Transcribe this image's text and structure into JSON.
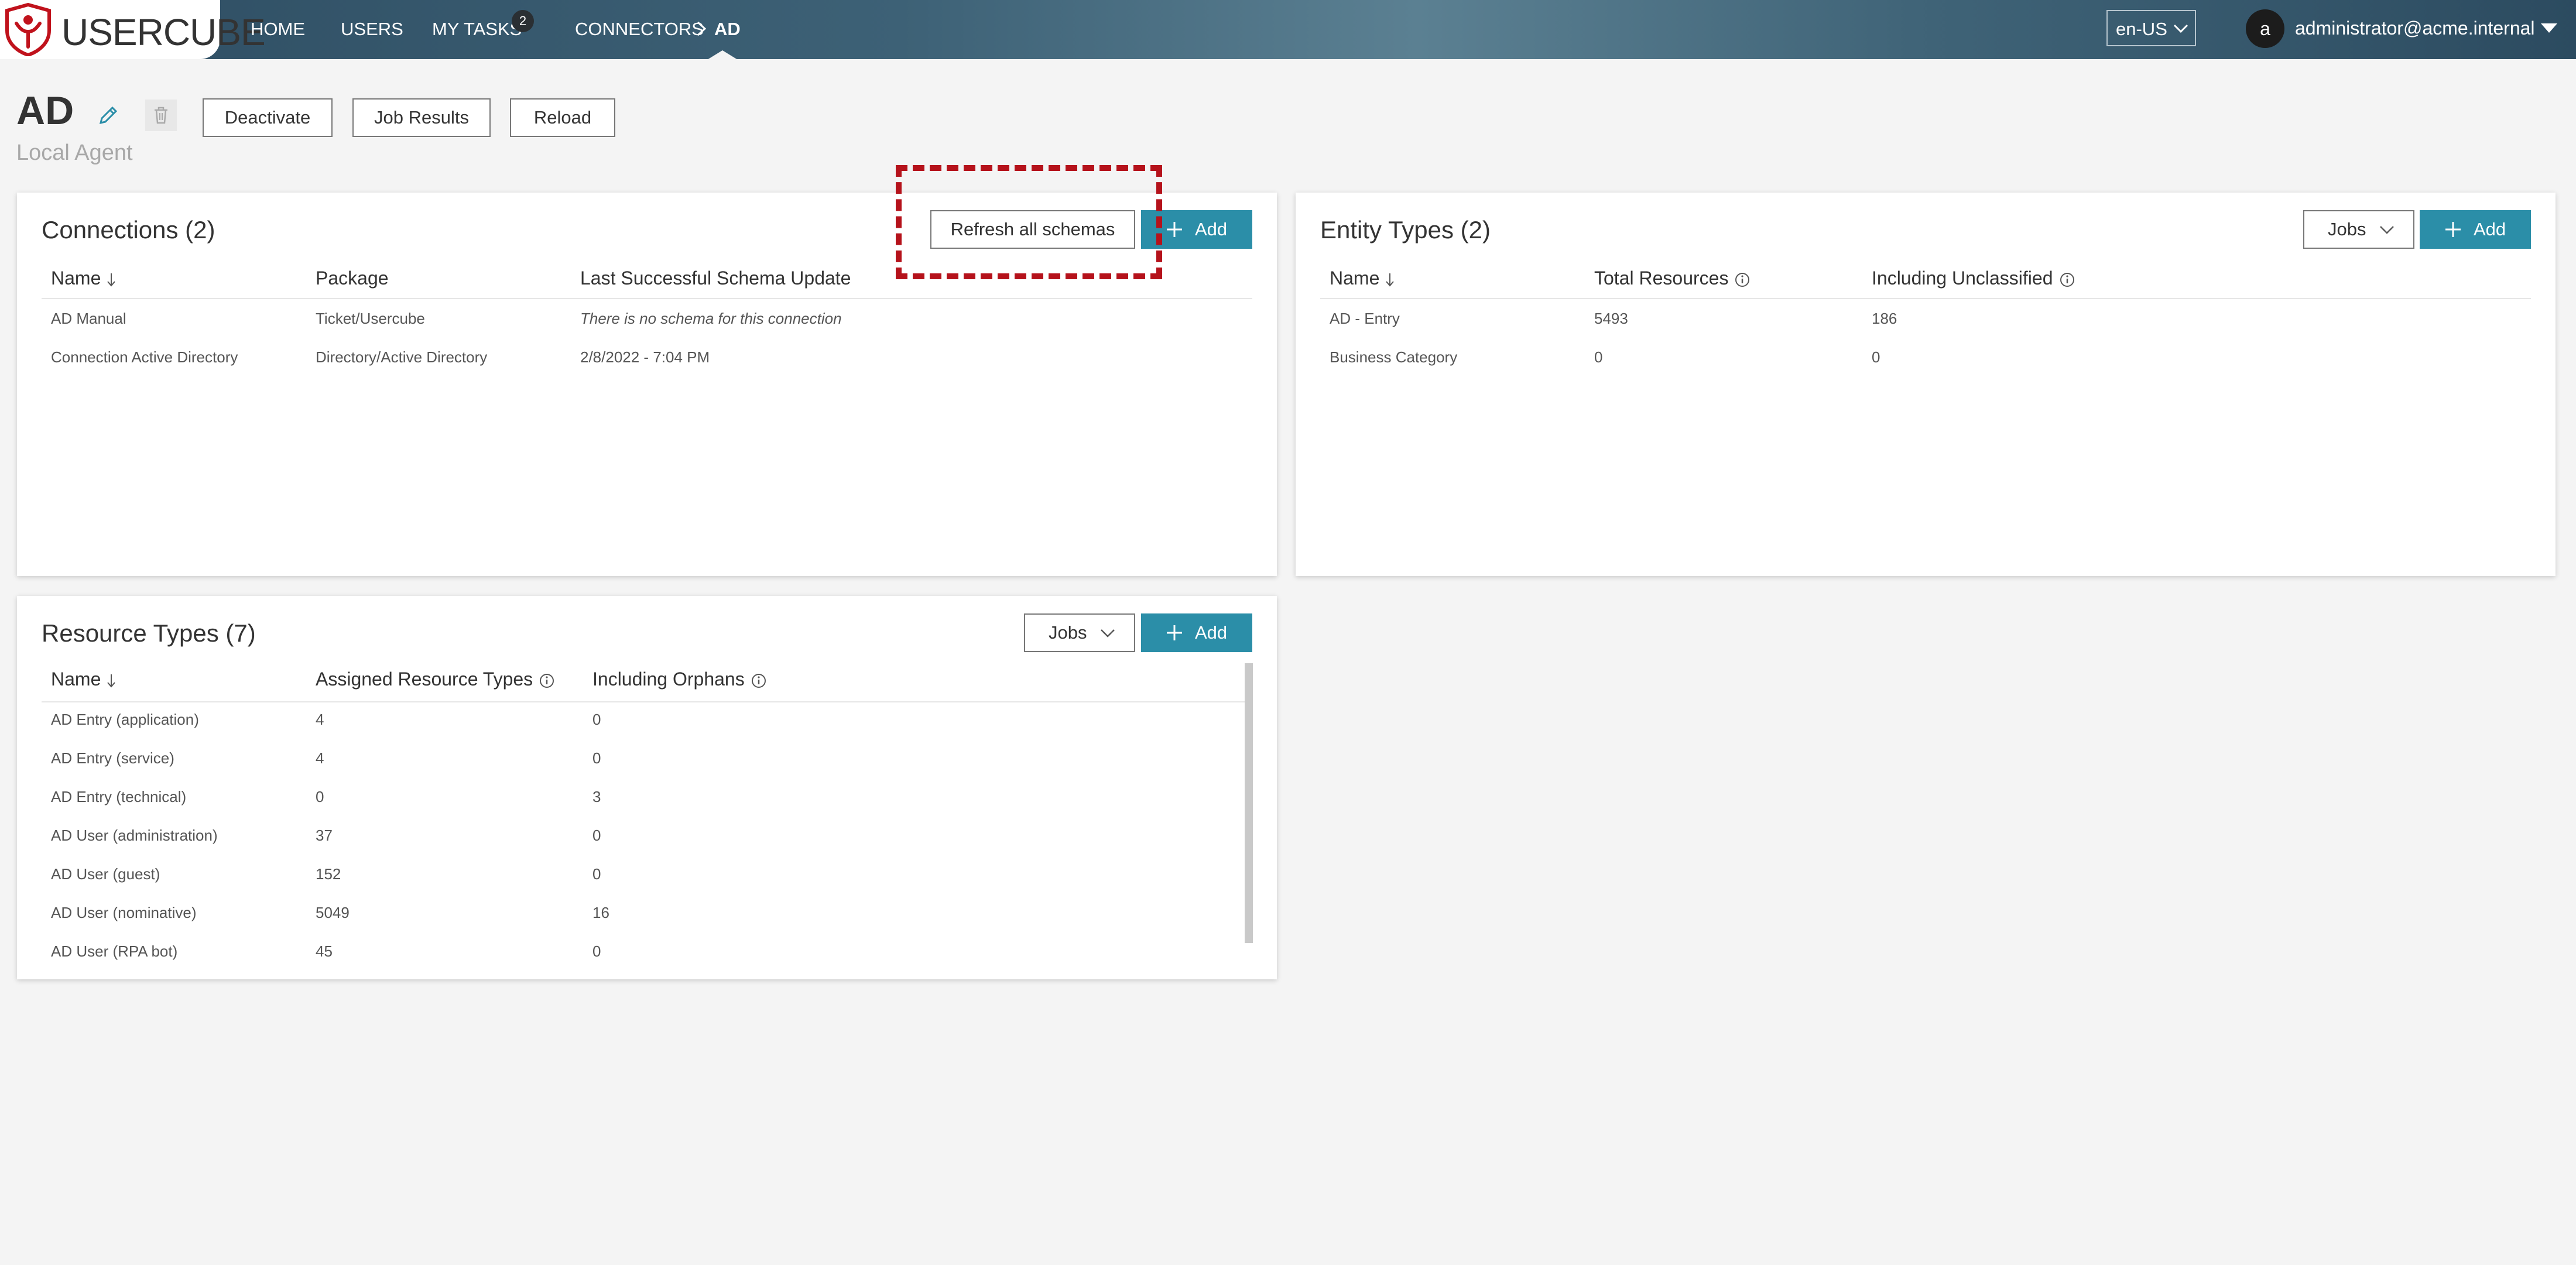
{
  "app": {
    "logo_text": "USERCUBE"
  },
  "nav": {
    "home": "HOME",
    "users": "USERS",
    "my_tasks": "MY TASKS",
    "my_tasks_badge": "2",
    "connectors": "CONNECTORS",
    "current": "AD"
  },
  "language": "en-US",
  "user": {
    "avatar_letter": "a",
    "email": "administrator@acme.internal"
  },
  "page": {
    "title": "AD",
    "subtitle": "Local Agent",
    "buttons": {
      "deactivate": "Deactivate",
      "job_results": "Job Results",
      "reload": "Reload"
    }
  },
  "connections": {
    "title": "Connections (2)",
    "refresh_label": "Refresh all schemas",
    "add_label": "Add",
    "columns": [
      "Name",
      "Package",
      "Last Successful Schema Update"
    ],
    "rows": [
      [
        "AD Manual",
        "Ticket/Usercube",
        "There is no schema for this connection"
      ],
      [
        "Connection Active Directory",
        "Directory/Active Directory",
        "2/8/2022  - 7:04 PM"
      ]
    ]
  },
  "entity_types": {
    "title": "Entity Types (2)",
    "jobs_label": "Jobs",
    "add_label": "Add",
    "columns": [
      "Name",
      "Total Resources",
      "Including Unclassified"
    ],
    "rows": [
      [
        "AD - Entry",
        "5493",
        "186"
      ],
      [
        "Business Category",
        "0",
        "0"
      ]
    ]
  },
  "resource_types": {
    "title": "Resource Types (7)",
    "jobs_label": "Jobs",
    "add_label": "Add",
    "columns": [
      "Name",
      "Assigned Resource Types",
      "Including Orphans"
    ],
    "rows": [
      [
        "AD Entry (application)",
        "4",
        "0"
      ],
      [
        "AD Entry (service)",
        "4",
        "0"
      ],
      [
        "AD Entry (technical)",
        "0",
        "3"
      ],
      [
        "AD User (administration)",
        "37",
        "0"
      ],
      [
        "AD User (guest)",
        "152",
        "0"
      ],
      [
        "AD User (nominative)",
        "5049",
        "16"
      ],
      [
        "AD User (RPA bot)",
        "45",
        "0"
      ]
    ]
  },
  "colors": {
    "primary": "#2b8ea8",
    "topbar": "#3d6176",
    "highlight": "#b5121b"
  }
}
